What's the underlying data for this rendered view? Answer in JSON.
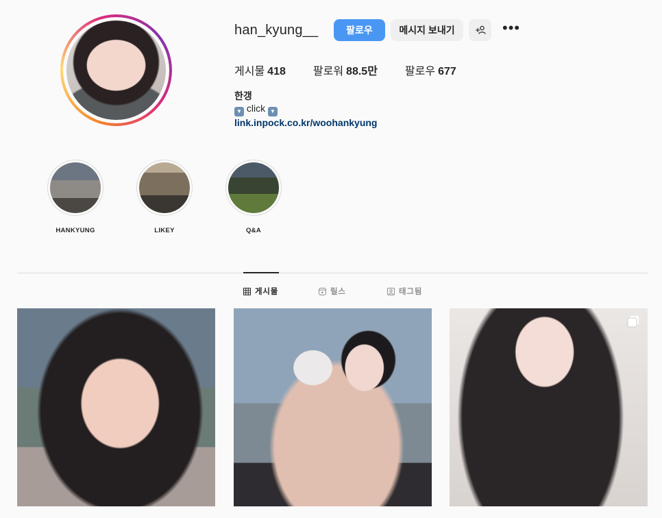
{
  "profile": {
    "username": "han_kyung__",
    "follow_label": "팔로우",
    "message_label": "메시지 보내기",
    "adduser_label": "+",
    "more_label": "•••",
    "stats": [
      {
        "label": "게시물",
        "value": "418"
      },
      {
        "label": "팔로워",
        "value": "88.5만"
      },
      {
        "label": "팔로우",
        "value": "677"
      }
    ],
    "bio": {
      "name": "한갱",
      "line": "click",
      "link": "link.inpock.co.kr/woohankyung"
    }
  },
  "highlights": [
    {
      "label": "HANKYUNG"
    },
    {
      "label": "LIKEY"
    },
    {
      "label": "Q&A"
    }
  ],
  "tabs": [
    {
      "label": "게시물",
      "icon": "grid-icon",
      "active": true
    },
    {
      "label": "릴스",
      "icon": "reels-icon",
      "active": false
    },
    {
      "label": "태그됨",
      "icon": "tagged-icon",
      "active": false
    }
  ],
  "colors": {
    "follow_button": "#4a97f3",
    "link": "#00376b",
    "divider": "#dbdbdb"
  }
}
